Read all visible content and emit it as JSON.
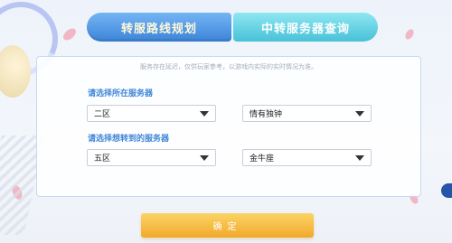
{
  "tabs": {
    "route_planning": "转服路线规划",
    "transfer_query": "中转服务器查询"
  },
  "notice": "服务存在延迟，仅供玩家参考，以游戏内实际的实时情况为准。",
  "current_server": {
    "label": "请选择所在服务器",
    "region": "二区",
    "server": "情有独钟"
  },
  "target_server": {
    "label": "请选择想转到的服务器",
    "region": "五区",
    "server": "金牛座"
  },
  "confirm_label": "确定",
  "colors": {
    "accent": "#3f86d8",
    "tab_active": "#3c84d8",
    "tab_secondary": "#48c1d8",
    "confirm": "#f1a92b"
  }
}
